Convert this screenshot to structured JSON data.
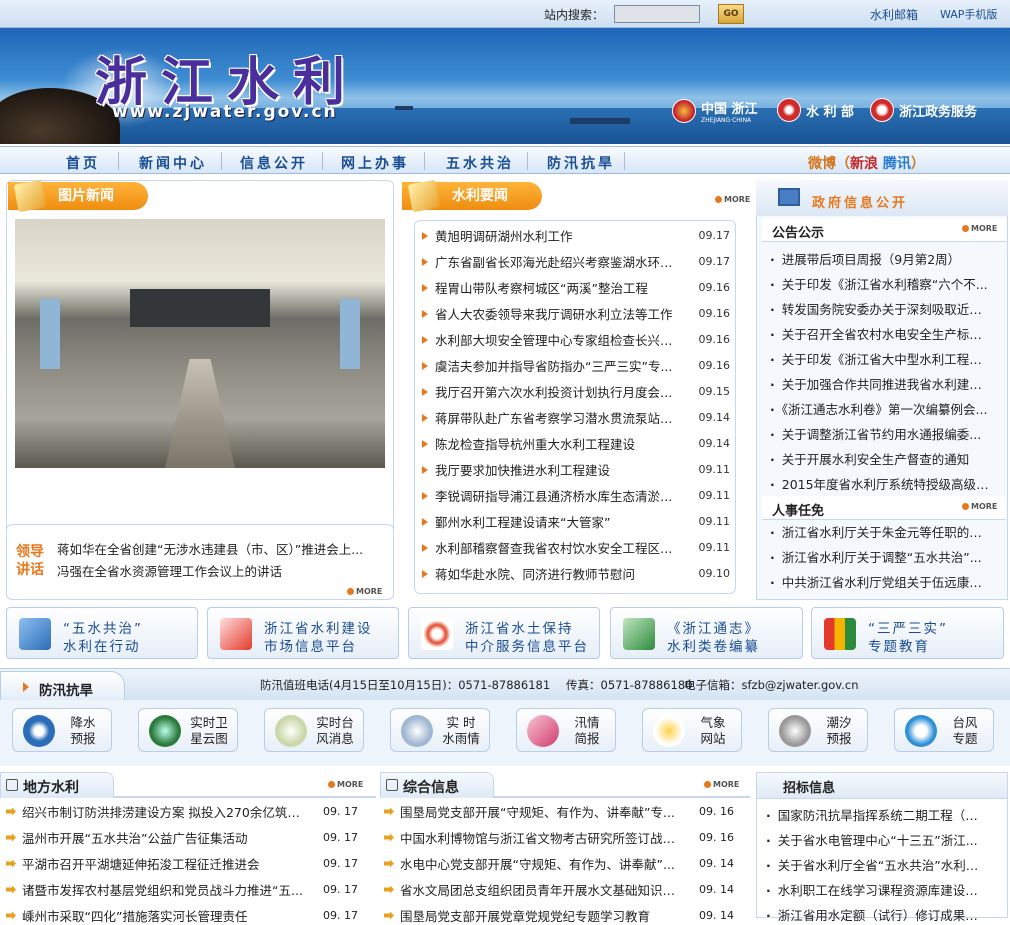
{
  "topbar": {
    "search_label": "站内搜索：",
    "search_value": "",
    "go_label": "GO",
    "links": [
      "水利邮箱",
      "WAP手机版"
    ]
  },
  "banner": {
    "title": "浙江水利",
    "url": "www.zjwater.gov.cn",
    "logos": [
      {
        "name": "中国 浙江",
        "sub": "ZHEJIANG·CHINA"
      },
      {
        "name": "水 利 部"
      },
      {
        "name": "浙江政务服务"
      }
    ]
  },
  "nav": {
    "items": [
      "首页",
      "新闻中心",
      "信息公开",
      "网上办事",
      "五水共治",
      "防汛抗旱"
    ],
    "weibo": {
      "label": "微博",
      "sina": "新浪",
      "tencent": "腾讯"
    }
  },
  "photo_news": {
    "title": "图片新闻"
  },
  "leaders": {
    "label": "领导讲话",
    "items": [
      "蒋如华在全省创建“无涉水违建县（市、区）”推进会上...",
      "冯强在全省水资源管理工作会议上的讲话"
    ],
    "more": "MORE"
  },
  "water_news": {
    "title": "水利要闻",
    "more": "MORE",
    "items": [
      {
        "t": "黄旭明调研湖州水利工作",
        "d": "09.17"
      },
      {
        "t": "广东省副省长邓海光赴绍兴考察鉴湖水环境...",
        "d": "09.17"
      },
      {
        "t": "程胃山带队考察柯城区“两溪”整治工程",
        "d": "09.16"
      },
      {
        "t": "省人大农委领导来我厅调研水利立法等工作",
        "d": "09.16"
      },
      {
        "t": "水利部大坝安全管理中心专家组检查长兴县...",
        "d": "09.16"
      },
      {
        "t": "虞洁夫参加并指导省防指办“三严三实”专...",
        "d": "09.16"
      },
      {
        "t": "我厅召开第六次水利投资计划执行月度会商会",
        "d": "09.15"
      },
      {
        "t": "蒋屏带队赴广东省考察学习潜水贯流泵站建...",
        "d": "09.14"
      },
      {
        "t": "陈龙检查指导杭州重大水利工程建设",
        "d": "09.14"
      },
      {
        "t": "我厅要求加快推进水利工程建设",
        "d": "09.11"
      },
      {
        "t": "李锐调研指导浦江县通济桥水库生态清淤工...",
        "d": "09.11"
      },
      {
        "t": "鄞州水利工程建设请来“大管家”",
        "d": "09.11"
      },
      {
        "t": "水利部稽察督查我省农村饮水安全工程区域...",
        "d": "09.11"
      },
      {
        "t": "蒋如华赴水院、同济进行教师节慰问",
        "d": "09.10"
      }
    ]
  },
  "gov_info": {
    "title": "政府信息公开",
    "notices": {
      "title": "公告公示",
      "more": "MORE",
      "items": [
        "进展带后项目周报（9月第2周）",
        "关于印发《浙江省水利稽察“六个不...",
        "转发国务院安委办关于深刻吸取近期...",
        "关于召开全省农村水电安全生产标准...",
        "关于印发《浙江省大中型水利工程管...",
        "关于加强合作共同推进我省水利建设...",
        "《浙江通志水利卷》第一次编纂例会...",
        "关于调整浙江省节约用水通报编委...",
        "关于开展水利安全生产督查的通知",
        "2015年度省水利厅系统特授级高级工..."
      ]
    },
    "personnel": {
      "title": "人事任免",
      "more": "MORE",
      "items": [
        "浙江省水利厅关于朱金元等任职的通知",
        "浙江省水利厅关于调整“五水共治”...",
        "中共浙江省水利厅党组关于伍远康同..."
      ]
    }
  },
  "quick_links": [
    {
      "l1": "“五水共治”",
      "l2": "水利在行动"
    },
    {
      "l1": "浙江省水利建设",
      "l2": "市场信息平台"
    },
    {
      "l1": "浙江省水土保持",
      "l2": "中介服务信息平台"
    },
    {
      "l1": "《浙江通志》",
      "l2": "水利类卷编纂"
    },
    {
      "l1": "“三严三实”",
      "l2": "专题教育"
    }
  ],
  "flood": {
    "title": "防汛抗旱",
    "duty_phone": "防汛值班电话(4月15日至10月15日)：0571-87886181",
    "fax": "传真：0571-87886180",
    "email": "电子信箱：sfzb@zjwater.gov.cn",
    "icons": [
      {
        "l1": "降水",
        "l2": "预报"
      },
      {
        "l1": "实时卫",
        "l2": "星云图"
      },
      {
        "l1": "实时台",
        "l2": "风消息"
      },
      {
        "l1": "实 时",
        "l2": "水雨情"
      },
      {
        "l1": "汛情",
        "l2": "简报"
      },
      {
        "l1": "气象",
        "l2": "网站"
      },
      {
        "l1": "潮汐",
        "l2": "预报"
      },
      {
        "l1": "台风",
        "l2": "专题"
      }
    ]
  },
  "local": {
    "title": "地方水利",
    "more": "MORE",
    "items": [
      {
        "t": "绍兴市制订防洪排涝建设方案 拟投入270余亿筑牢...",
        "d": "09. 17"
      },
      {
        "t": "温州市开展“五水共治”公益广告征集活动",
        "d": "09. 17"
      },
      {
        "t": "平湖市召开平湖塘延伸拓浚工程征迁推进会",
        "d": "09. 17"
      },
      {
        "t": "诸暨市发挥农村基层党组织和党员战斗力推进“五...",
        "d": "09. 17"
      },
      {
        "t": "嵊州市采取“四化”措施落实河长管理责任",
        "d": "09. 17"
      }
    ]
  },
  "general": {
    "title": "综合信息",
    "more": "MORE",
    "items": [
      {
        "t": "围垦局党支部开展“守规矩、有作为、讲奉献”专...",
        "d": "09. 16"
      },
      {
        "t": "中国水利博物馆与浙江省文物考古研究所签订战略...",
        "d": "09. 16"
      },
      {
        "t": "水电中心党支部开展“守规矩、有作为、讲奉献”...",
        "d": "09. 14"
      },
      {
        "t": "省水文局团总支组织团员青年开展水文基础知识学习",
        "d": "09. 14"
      },
      {
        "t": "围垦局党支部开展党章党规党纪专题学习教育",
        "d": "09. 14"
      }
    ]
  },
  "bids": {
    "title": "招标信息",
    "items": [
      "国家防汛抗旱指挥系统二期工程（浙...",
      "关于省水电管理中心“十三五”浙江...",
      "关于省水利厅全省“五水共治”水利人...",
      "水利职工在线学习课程资源库建设与...",
      "浙江省用水定额（试行）修订成果复..."
    ]
  }
}
